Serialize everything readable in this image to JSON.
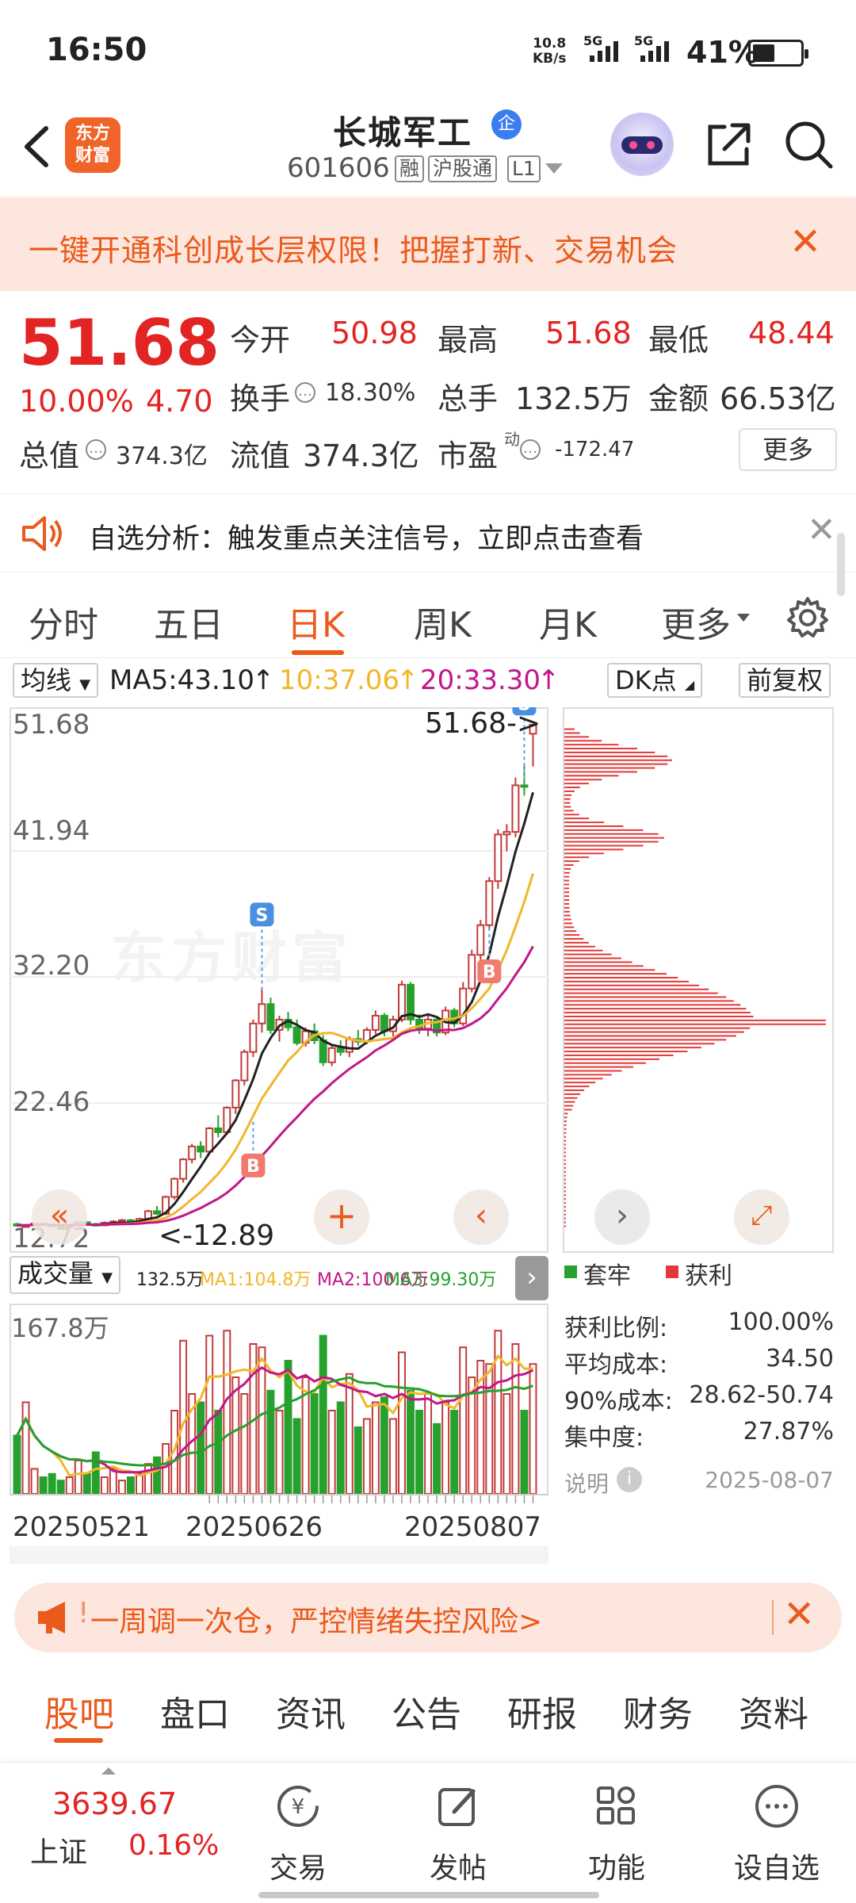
{
  "status_bar": {
    "time": "16:50",
    "net_speed": "10.8",
    "net_unit": "KB/s",
    "sig1": "5G",
    "sig2": "5G",
    "battery": "41%"
  },
  "header": {
    "logo_line1": "东方",
    "logo_line2": "财富",
    "title": "长城军工",
    "title_badge": "企",
    "code": "601606",
    "tags": [
      "融",
      "沪股通",
      "L1"
    ]
  },
  "promo_banner": {
    "text": "一键开通科创成长层权限！把握打新、交易机会"
  },
  "quote": {
    "price": "51.68",
    "change_pct": "10.00%",
    "change_amt": "4.70",
    "labels": {
      "open": "今开",
      "high": "最高",
      "low": "最低",
      "turnover": "换手",
      "volume": "总手",
      "amount": "金额",
      "mktcap": "总值",
      "float": "流值",
      "pe": "市盈",
      "pe_sup": "动"
    },
    "open": "50.98",
    "high": "51.68",
    "low": "48.44",
    "turnover": "18.30%",
    "volume": "132.5万",
    "amount": "66.53亿",
    "mktcap": "374.3亿",
    "float": "374.3亿",
    "pe": "-172.47",
    "more": "更多"
  },
  "analysis": {
    "text": "自选分析：触发重点关注信号，立即点击查看"
  },
  "tabs": {
    "items": [
      "分时",
      "五日",
      "日K",
      "周K",
      "月K",
      "更多"
    ],
    "active": "日K"
  },
  "chart": {
    "ma_selector": "均线",
    "ma5": "MA5:43.10",
    "ma10": "10:37.06",
    "ma20": "20:33.30",
    "dk_button": "DK点",
    "adjust_button": "前复权",
    "y_ticks": [
      "51.68",
      "41.94",
      "32.20",
      "22.46",
      "12.72"
    ],
    "max_label": "51.68->",
    "min_label": "<-12.89",
    "watermark": "东方财富",
    "vol_selector": "成交量",
    "vol_value": "132.5万",
    "vol_ma1": "MA1:104.8万",
    "vol_ma2": "MA2:100.6万",
    "vol_ma3": "MA3:99.30万",
    "vol_max": "167.8万",
    "dates": [
      "20250521",
      "20250626",
      "20250807"
    ],
    "colors": {
      "up": "#c33a3a",
      "down": "#27a12e",
      "ma5": "#222222",
      "ma10": "#f1b72a",
      "ma20": "#c2168a"
    }
  },
  "chip": {
    "legend_loss": "套牢",
    "legend_profit": "获利",
    "rows": [
      {
        "label": "获利比例:",
        "value": "100.00%"
      },
      {
        "label": "平均成本:",
        "value": "34.50"
      },
      {
        "label": "90%成本:",
        "value": "28.62-50.74"
      },
      {
        "label": "集中度:",
        "value": "27.87%"
      }
    ],
    "note": "说明",
    "date": "2025-08-07"
  },
  "warn_banner": {
    "text": "一周调一次仓，严控情绪失控风险>"
  },
  "sub_tabs": {
    "items": [
      "股吧",
      "盘口",
      "资讯",
      "公告",
      "研报",
      "财务",
      "资料"
    ],
    "active": "股吧"
  },
  "bottom_nav": {
    "index_value": "3639.67",
    "index_name": "上证",
    "index_change": "0.16%",
    "items": [
      {
        "label": "交易",
        "icon": "trade-icon"
      },
      {
        "label": "发帖",
        "icon": "edit-icon"
      },
      {
        "label": "功能",
        "icon": "grid-icon"
      },
      {
        "label": "设自选",
        "icon": "more-icon"
      }
    ]
  },
  "chart_data": {
    "type": "candlestick",
    "y_range": [
      12.72,
      51.68
    ],
    "candles": [
      [
        13.1,
        13.2,
        12.9,
        13.0
      ],
      [
        13.0,
        13.1,
        12.9,
        13.0
      ],
      [
        13.0,
        13.2,
        12.95,
        13.15
      ],
      [
        13.15,
        13.2,
        13.0,
        13.05
      ],
      [
        13.05,
        13.1,
        12.95,
        13.0
      ],
      [
        13.0,
        13.1,
        12.9,
        12.95
      ],
      [
        12.95,
        13.0,
        12.89,
        12.98
      ],
      [
        12.98,
        13.3,
        12.95,
        13.25
      ],
      [
        13.25,
        13.3,
        13.0,
        13.1
      ],
      [
        13.1,
        13.2,
        12.95,
        13.0
      ],
      [
        13.0,
        13.3,
        12.98,
        13.2
      ],
      [
        13.2,
        13.4,
        13.1,
        13.3
      ],
      [
        13.3,
        13.5,
        13.2,
        13.4
      ],
      [
        13.4,
        13.5,
        13.1,
        13.2
      ],
      [
        13.2,
        13.6,
        13.1,
        13.5
      ],
      [
        13.5,
        14.2,
        13.4,
        14.1
      ],
      [
        14.1,
        14.5,
        13.8,
        13.9
      ],
      [
        13.9,
        15.3,
        13.8,
        15.2
      ],
      [
        15.2,
        16.7,
        15.0,
        16.6
      ],
      [
        16.6,
        18.2,
        16.3,
        18.1
      ],
      [
        18.1,
        19.3,
        17.8,
        19.1
      ],
      [
        19.1,
        19.5,
        18.2,
        18.7
      ],
      [
        18.7,
        20.6,
        18.5,
        20.5
      ],
      [
        20.5,
        21.5,
        19.8,
        20.2
      ],
      [
        20.2,
        22.2,
        20.0,
        22.1
      ],
      [
        22.1,
        24.3,
        21.6,
        24.2
      ],
      [
        24.2,
        26.6,
        23.8,
        26.4
      ],
      [
        26.4,
        28.9,
        26.0,
        28.6
      ],
      [
        28.6,
        31.2,
        27.9,
        30.1
      ],
      [
        30.1,
        30.6,
        27.8,
        28.1
      ],
      [
        28.1,
        29.2,
        27.2,
        28.9
      ],
      [
        28.9,
        29.5,
        28.0,
        28.3
      ],
      [
        28.3,
        28.9,
        26.9,
        27.1
      ],
      [
        27.1,
        28.3,
        26.8,
        28.0
      ],
      [
        28.0,
        28.6,
        27.0,
        27.3
      ],
      [
        27.3,
        27.7,
        25.3,
        25.6
      ],
      [
        25.6,
        26.9,
        25.3,
        26.7
      ],
      [
        26.7,
        27.3,
        26.1,
        26.4
      ],
      [
        26.4,
        27.6,
        26.0,
        27.4
      ],
      [
        27.4,
        28.1,
        26.9,
        27.2
      ],
      [
        27.2,
        28.3,
        27.0,
        28.1
      ],
      [
        28.1,
        29.6,
        27.8,
        29.2
      ],
      [
        29.2,
        29.4,
        27.6,
        28.0
      ],
      [
        28.0,
        29.2,
        27.6,
        28.9
      ],
      [
        28.9,
        31.9,
        28.7,
        31.6
      ],
      [
        31.6,
        31.8,
        28.5,
        28.9
      ],
      [
        28.9,
        29.3,
        27.8,
        28.2
      ],
      [
        28.2,
        29.2,
        27.6,
        28.9
      ],
      [
        28.9,
        29.1,
        27.6,
        27.9
      ],
      [
        27.9,
        29.9,
        27.7,
        29.6
      ],
      [
        29.6,
        29.8,
        28.3,
        28.6
      ],
      [
        28.6,
        31.8,
        28.4,
        31.3
      ],
      [
        31.3,
        34.3,
        31.0,
        33.9
      ],
      [
        33.9,
        36.6,
        33.0,
        36.2
      ],
      [
        36.2,
        39.9,
        35.8,
        39.6
      ],
      [
        39.6,
        43.6,
        39.0,
        43.2
      ],
      [
        43.2,
        44.0,
        41.9,
        43.4
      ],
      [
        43.4,
        47.6,
        43.0,
        47.0
      ],
      [
        47.0,
        48.5,
        46.2,
        46.98
      ],
      [
        50.98,
        51.68,
        48.44,
        51.68
      ]
    ]
  }
}
